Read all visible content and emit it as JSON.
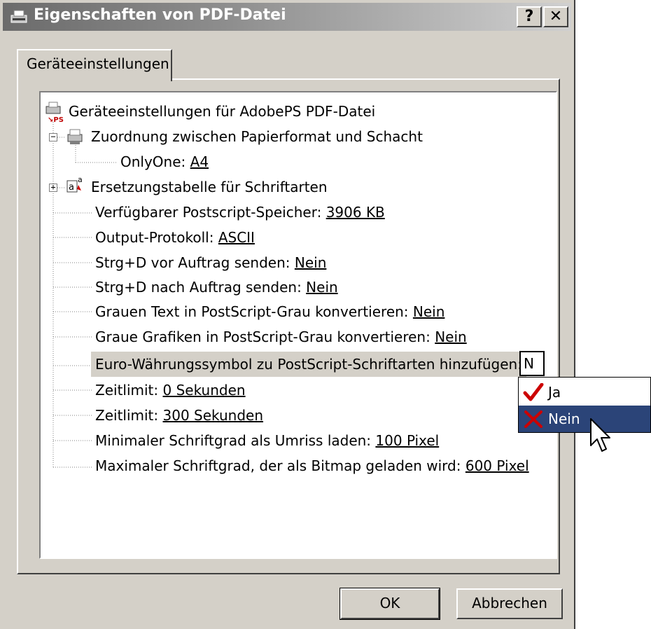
{
  "window": {
    "title": "Eigenschaften von PDF-Datei",
    "title_icon": "printer-icon",
    "help_label": "?",
    "close_label": "✕"
  },
  "tabs": [
    {
      "label": "Geräteeinstellungen",
      "active": true
    }
  ],
  "tree": {
    "root": {
      "label": "Geräteeinstellungen für AdobePS PDF-Datei",
      "icon": "printer-ps-icon"
    },
    "paper_mapping": {
      "label": "Zuordnung zwischen Papierformat und Schacht",
      "icon": "printer-tray-icon",
      "expanded": true
    },
    "onlyone": {
      "label": "OnlyOne: ",
      "value": "A4"
    },
    "font_sub": {
      "label": "Ersetzungstabelle für Schriftarten",
      "icon": "font-substitution-icon",
      "expanded": false
    },
    "items": [
      {
        "label": "Verfügbarer Postscript-Speicher: ",
        "value": "3906 KB"
      },
      {
        "label": "Output-Protokoll: ",
        "value": "ASCII"
      },
      {
        "label": "Strg+D vor Auftrag senden: ",
        "value": "Nein"
      },
      {
        "label": "Strg+D nach Auftrag senden: ",
        "value": "Nein"
      },
      {
        "label": "Grauen Text in PostScript-Grau konvertieren: ",
        "value": "Nein"
      },
      {
        "label": "Graue Grafiken in PostScript-Grau konvertieren: ",
        "value": "Nein"
      },
      {
        "label": "Euro-Währungssymbol zu PostScript-Schriftarten hinzufügen:",
        "value": ""
      },
      {
        "label": "Zeitlimit: ",
        "value": "0 Sekunden"
      },
      {
        "label": "Zeitlimit: ",
        "value": "300 Sekunden"
      },
      {
        "label": "Minimaler Schriftgrad als Umriss laden: ",
        "value": "100 Pixel"
      },
      {
        "label": "Maximaler Schriftgrad, der als Bitmap geladen wird: ",
        "value": "600 Pixel"
      }
    ]
  },
  "editor": {
    "value": "N"
  },
  "dropdown": {
    "options": [
      {
        "label": "Ja",
        "icon": "checkmark-icon",
        "selected": false
      },
      {
        "label": "Nein",
        "icon": "x-mark-icon",
        "selected": true
      }
    ]
  },
  "buttons": {
    "ok": "OK",
    "cancel": "Abbrechen"
  },
  "colors": {
    "selection": "#2b4478",
    "dialog_bg": "#d4d0c8",
    "check": "#cc0000"
  }
}
